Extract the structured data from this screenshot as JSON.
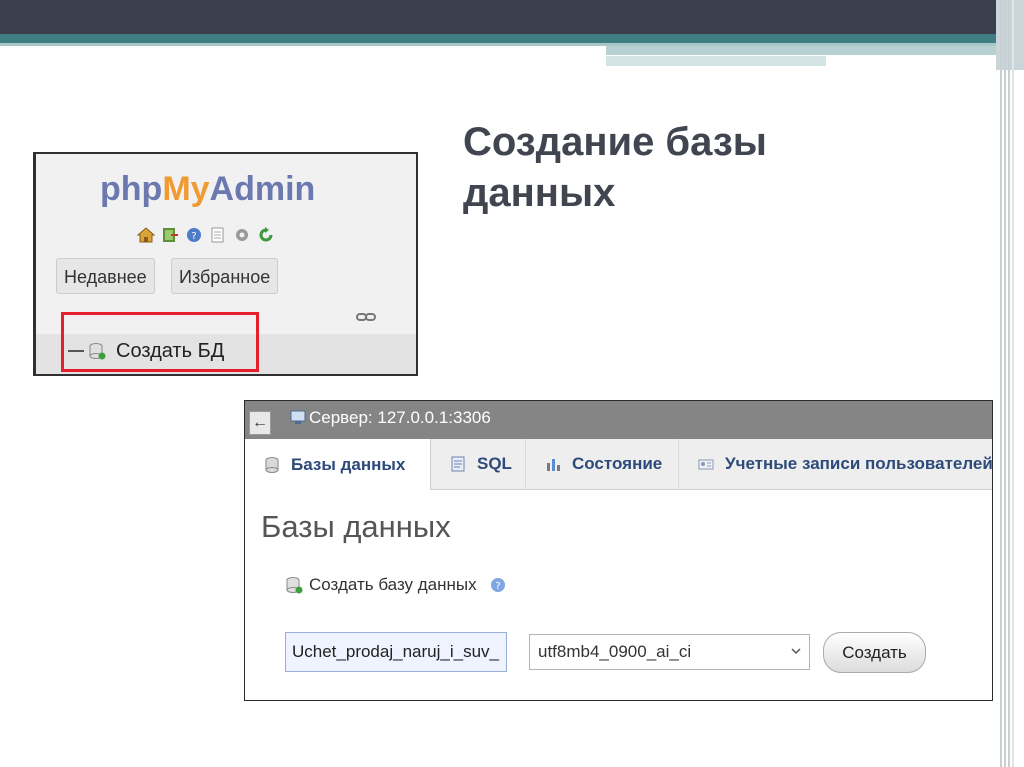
{
  "slide": {
    "title": "Создание базы данных"
  },
  "pma_panel": {
    "logo": {
      "php": "php",
      "my": "My",
      "admin": "Admin"
    },
    "icons": [
      "home-icon",
      "exit-icon",
      "help-icon",
      "docs-icon",
      "settings-icon",
      "reload-icon"
    ],
    "tabs": {
      "recent": "Недавнее",
      "favorites": "Избранное"
    },
    "new_db": "Создать БД",
    "highlight_color": "#e5202a"
  },
  "server_page": {
    "server_label": "Сервер: 127.0.0.1:3306",
    "tabs": [
      {
        "label": "Базы данных",
        "icon": "database-icon",
        "active": true
      },
      {
        "label": "SQL",
        "icon": "sql-icon",
        "active": false
      },
      {
        "label": "Состояние",
        "icon": "status-icon",
        "active": false
      },
      {
        "label": "Учетные записи пользователей",
        "icon": "users-icon",
        "active": false
      }
    ],
    "heading": "Базы данных",
    "create_db_label": "Создать базу данных",
    "db_name_value": "Uchet_prodaj_naruj_i_suv_",
    "collation_value": "utf8mb4_0900_ai_ci",
    "create_button": "Создать"
  }
}
